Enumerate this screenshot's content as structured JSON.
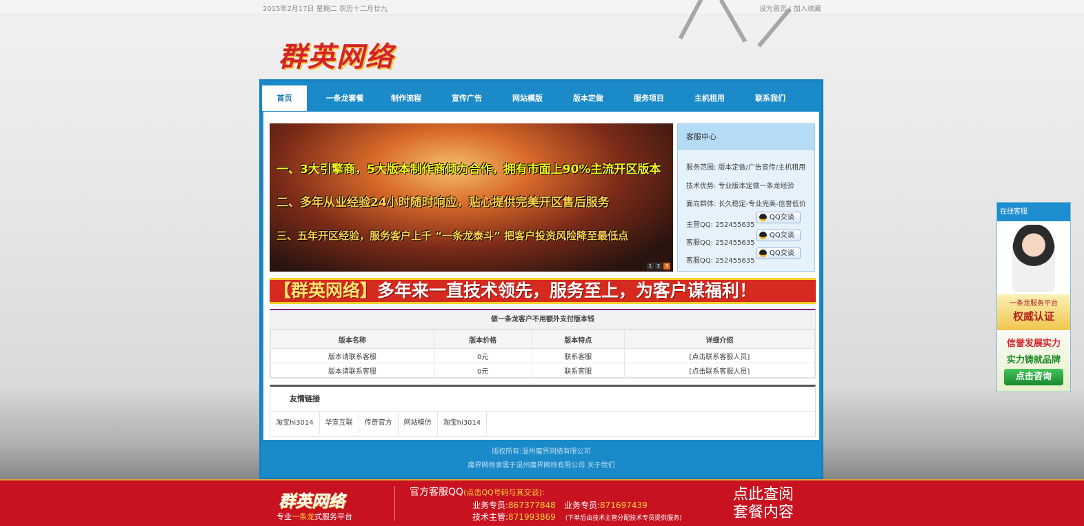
{
  "topbar": {
    "date": "2015年2月17日 星期二 农历十二月廿九",
    "set_home": "设为首页",
    "add_fav": "加入收藏"
  },
  "logo": {
    "text": "群英网络"
  },
  "nav": {
    "items": [
      "首页",
      "一条龙套餐",
      "制作流程",
      "宣传广告",
      "网站模版",
      "版本定做",
      "服务项目",
      "主机租用",
      "联系我们"
    ],
    "active": "首页"
  },
  "banner": {
    "lines": [
      "一、3大引擎商，5大版本制作商倾力合作，拥有市面上90%主流开区版本",
      "二、多年从业经验24小时随时响应，贴心提供完美开区售后服务",
      "三、五年开区经验，服务客户上千 “一条龙泰斗” 把客户投资风险降至最低点"
    ],
    "dots": [
      "1",
      "2",
      "3"
    ]
  },
  "service": {
    "title": "客服中心",
    "scope_label": "服务范围:",
    "scope": "版本定做/广告宣传/主机租用",
    "tech_label": "技术优势:",
    "tech": "专业版本定做一条龙经验",
    "audience_label": "面向群体:",
    "audience": "长久稳定-专业完美-信誉低价",
    "qq_rows": [
      {
        "label": "主营QQ:",
        "number": "252455635",
        "button": "QQ交谈"
      },
      {
        "label": "客服QQ:",
        "number": "252455635",
        "button": "QQ交谈"
      },
      {
        "label": "客服QQ:",
        "number": "252455635",
        "button": "QQ交谈"
      }
    ]
  },
  "slogan": {
    "bracket": "【群英网络】",
    "text": "多年来一直技术领先，服务至上，为客户谋福利！"
  },
  "version_table": {
    "title": "做一条龙客户不用额外支付版本钱",
    "headers": [
      "版本名称",
      "版本价格",
      "版本特点",
      "详细介绍"
    ],
    "rows": [
      [
        "版本请联系客服",
        "0元",
        "联系客服",
        "[点击联系客服人员]"
      ],
      [
        "版本请联系客服",
        "0元",
        "联系客服",
        "[点击联系客服人员]"
      ]
    ]
  },
  "friends": {
    "title": "友情链接",
    "links": [
      "淘宝hi3014",
      "华宣互联",
      "传奇官方",
      "网站模仿",
      "淘宝hi3014"
    ]
  },
  "footer": {
    "copyright": "版权所有:温州魔界网络有限公司",
    "belongs": "魔界网络隶属于温州魔界网络有限公司",
    "about": "关于我们"
  },
  "side_panel": {
    "title": "在线客服",
    "line1": "一条龙服务平台",
    "line2": "权威认证",
    "line3": "信誉发展实力",
    "line4": "实力铸就品牌",
    "button": "点击咨询"
  },
  "bottom_bar": {
    "logo": "群英网络",
    "tag_pre": "专业",
    "tag_mid": "一条龙",
    "tag_post": "式服务平台",
    "qq_title": "官方客服QQ",
    "qq_hint": "(点击QQ号码与其交谈):",
    "sales1_label": "业务专员:",
    "sales1": "867377848",
    "sales2_label": "业务专员:",
    "sales2": "871697439",
    "tech_label": "技术主管:",
    "tech": "871993869",
    "tech_note": "(下单后由技术主管分配技术专员提供服务)",
    "check_line1": "点此查阅",
    "check_line2": "套餐内容"
  },
  "colors": {
    "nav_blue": "#1a8ac8",
    "bottom_red": "#c8121f",
    "highlight_yellow": "#ffd23b",
    "active_nav_text": "#1a7ab8"
  }
}
